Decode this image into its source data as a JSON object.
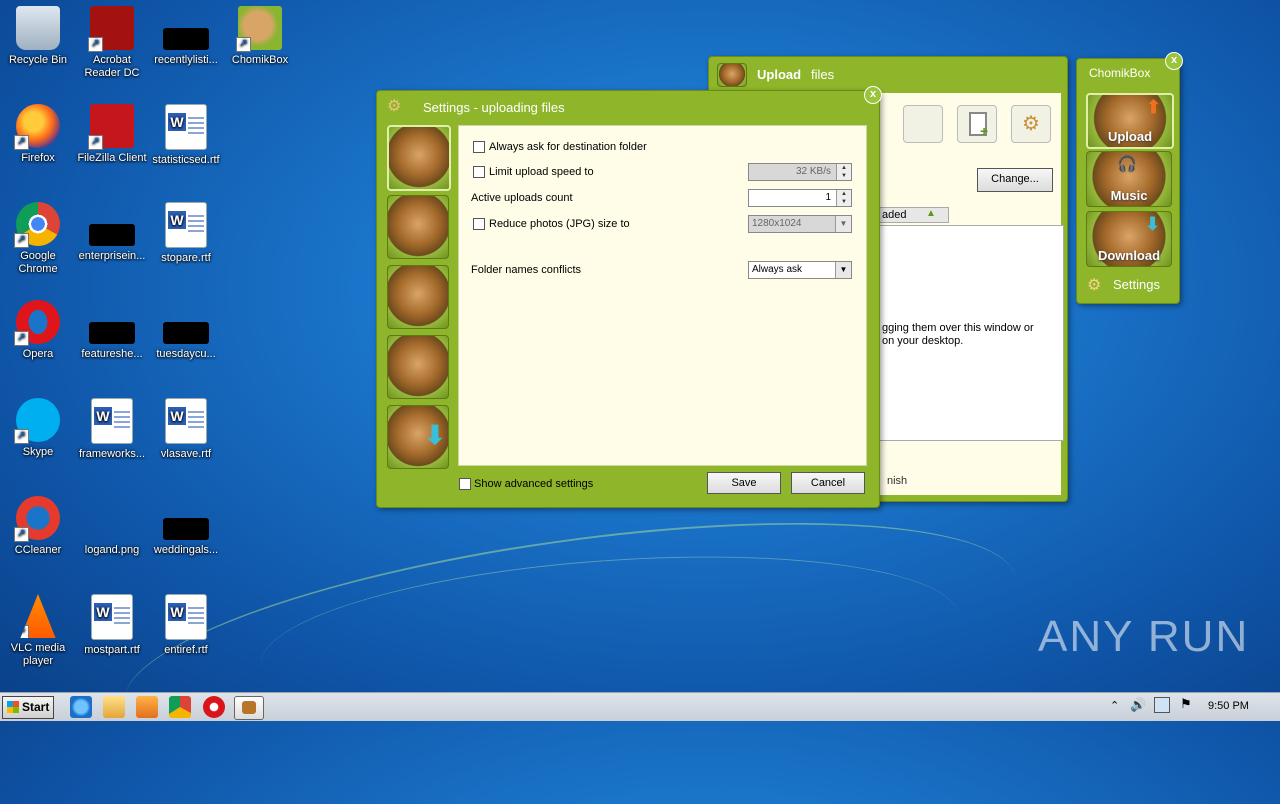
{
  "desktop": {
    "icons": [
      {
        "label": "Recycle Bin",
        "icon": "recycle-bin-icon"
      },
      {
        "label": "Acrobat Reader DC",
        "icon": "acrobat-icon"
      },
      {
        "label": "recentlylisti...",
        "icon": "blank-file-icon"
      },
      {
        "label": "ChomikBox",
        "icon": "chomikbox-icon"
      },
      {
        "label": "Firefox",
        "icon": "firefox-icon"
      },
      {
        "label": "FileZilla Client",
        "icon": "filezilla-icon"
      },
      {
        "label": "statisticsed.rtf",
        "icon": "word-doc-icon"
      },
      {
        "label": "Google Chrome",
        "icon": "chrome-icon"
      },
      {
        "label": "enterprisein...",
        "icon": "blank-file-icon"
      },
      {
        "label": "stopare.rtf",
        "icon": "word-doc-icon"
      },
      {
        "label": "Opera",
        "icon": "opera-icon"
      },
      {
        "label": "featureshe...",
        "icon": "blank-file-icon"
      },
      {
        "label": "tuesdaycu...",
        "icon": "blank-file-icon"
      },
      {
        "label": "Skype",
        "icon": "skype-icon"
      },
      {
        "label": "frameworks...",
        "icon": "word-doc-icon"
      },
      {
        "label": "vlasave.rtf",
        "icon": "word-doc-icon"
      },
      {
        "label": "CCleaner",
        "icon": "ccleaner-icon"
      },
      {
        "label": "logand.png",
        "icon": "image-file-icon"
      },
      {
        "label": "weddingals...",
        "icon": "blank-file-icon"
      },
      {
        "label": "VLC media player",
        "icon": "vlc-icon"
      },
      {
        "label": "mostpart.rtf",
        "icon": "word-doc-icon"
      },
      {
        "label": "entiref.rtf",
        "icon": "word-doc-icon"
      }
    ],
    "watermark": "ANY RUN"
  },
  "upload_window": {
    "title_bold": "Upload",
    "title_rest": "files",
    "change_button": "Change...",
    "column_header": "aded",
    "drop_hint_line1": "gging them over this window or",
    "drop_hint_line2": "on your desktop.",
    "footer_text": "nish"
  },
  "chomikbox_panel": {
    "title": "ChomikBox",
    "upload_label": "Upload",
    "music_label": "Music",
    "download_label": "Download",
    "settings_label": "Settings"
  },
  "settings_dialog": {
    "title": "Settings - uploading files",
    "always_ask_label": "Always ask for destination folder",
    "limit_speed_label": "Limit upload speed to",
    "limit_speed_value": "32 KB/s",
    "active_uploads_label": "Active uploads count",
    "active_uploads_value": "1",
    "reduce_photos_label": "Reduce photos (JPG) size to",
    "reduce_photos_value": "1280x1024",
    "folder_conflicts_label": "Folder names conflicts",
    "folder_conflicts_value": "Always ask",
    "show_advanced_label": "Show advanced settings",
    "save_button": "Save",
    "cancel_button": "Cancel"
  },
  "taskbar": {
    "start_label": "Start",
    "clock": "9:50 PM"
  }
}
